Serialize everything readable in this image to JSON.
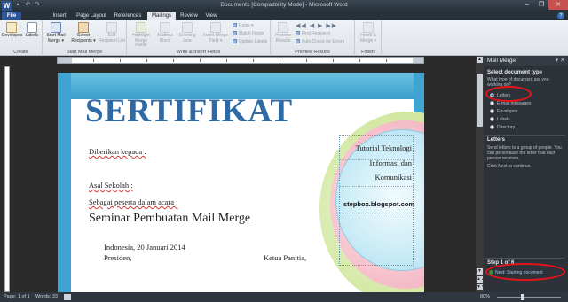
{
  "window": {
    "title": "Document1 [Compatibility Mode] - Microsoft Word",
    "app_icon": "W",
    "quick_access": [
      "save-icon",
      "undo-icon",
      "redo-icon"
    ],
    "controls": [
      "minimize",
      "maximize",
      "close"
    ],
    "control_glyphs": [
      "–",
      "❐",
      "✕"
    ]
  },
  "tabs": {
    "file": "File",
    "items": [
      "Insert",
      "Page Layout",
      "References",
      "Mailings",
      "Review",
      "View"
    ],
    "active": "Mailings",
    "help_glyph": "?"
  },
  "ribbon": {
    "groups": {
      "create": {
        "label": "Create",
        "envelopes": "Envelopes",
        "labels": "Labels"
      },
      "start": {
        "label": "Start Mail Merge",
        "start_mail_merge": "Start Mail Merge ▾",
        "select_recipients": "Select Recipients ▾",
        "edit_recipient_list": "Edit Recipient List"
      },
      "write": {
        "label": "Write & Insert Fields",
        "highlight_merge_fields": "Highlight Merge Fields",
        "address_block": "Address Block",
        "greeting_line": "Greeting Line",
        "insert_merge_field": "Insert Merge Field ▾",
        "rules": "Rules ▾",
        "match_fields": "Match Fields",
        "update_labels": "Update Labels"
      },
      "preview": {
        "label": "Preview Results",
        "preview_results": "Preview Results",
        "find_recipient": "Find Recipient",
        "auto_check": "Auto Check for Errors"
      },
      "finish": {
        "label": "Finish",
        "finish_merge": "Finish & Merge ▾"
      }
    }
  },
  "document": {
    "heading": "SERTIFIKAT",
    "lines": {
      "diberikan": "Diberikan kepada :",
      "asal": "Asal Sekolah :",
      "sebagai": "Sebagai peserta dalam acara :",
      "seminar": "Seminar Pembuatan Mail Merge",
      "date": "Indonesia, 20 Januari 2014",
      "presiden": "Presiden,",
      "ketua": "Ketua Panitia,"
    },
    "textbox": {
      "line1": "Tutorial Teknologi",
      "line2": "Informasi dan",
      "line3": "Komunikasi",
      "blog": "stepbox.blogspot.com"
    }
  },
  "scrollbar": {
    "up_glyph": "▲",
    "down_glyph": "▼",
    "page_up_glyph": "▲▲",
    "page_down_glyph": "▼▼"
  },
  "task_pane": {
    "title": "Mail Merge",
    "close_glyph": "▾ ✕",
    "select_type_heading": "Select document type",
    "select_type_prompt": "What type of document are you working on?",
    "options": [
      "Letters",
      "E-mail messages",
      "Envelopes",
      "Labels",
      "Directory"
    ],
    "selected": "Letters",
    "letters_heading": "Letters",
    "letters_desc": "Send letters to a group of people. You can personalize the letter that each person receives.",
    "letters_next": "Click Next to continue.",
    "step_label": "Step 1 of 6",
    "next_link": "Next: Starting document"
  },
  "status_bar": {
    "page": "Page: 1 of 1",
    "words": "Words: 33",
    "zoom": "80%",
    "zoom_level": 0.8
  },
  "colors": {
    "file_tab": "#2a5699",
    "annotation": "#e3151b",
    "heading": "#2e6aa6"
  }
}
